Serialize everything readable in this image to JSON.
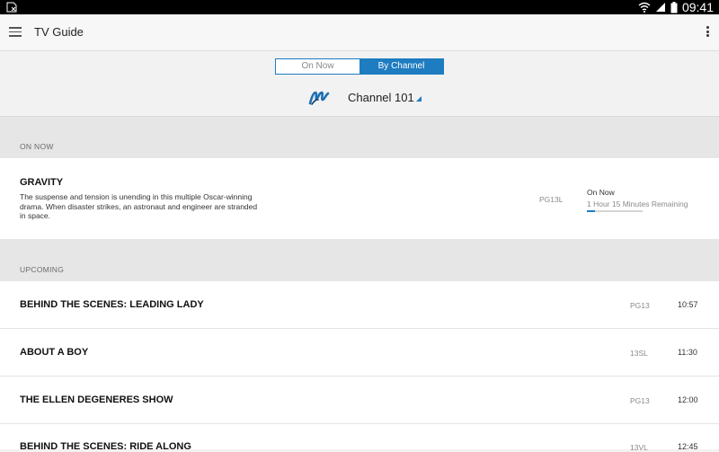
{
  "status_bar": {
    "time": "09:41"
  },
  "app": {
    "title": "TV Guide"
  },
  "segments": [
    "On Now",
    "By Channel"
  ],
  "channel": {
    "label": "Channel 101"
  },
  "sections": {
    "on_now": "ON NOW",
    "upcoming": "UPCOMING"
  },
  "on_now": {
    "title": "GRAVITY",
    "description": "The suspense and tension is unending in this multiple Oscar-winning drama. When disaster strikes, an astronaut and engineer are stranded in space.",
    "rating": "PG13L",
    "status": "On Now",
    "remaining": "1 Hour 15 Minutes Remaining",
    "progress_fraction": 0.15
  },
  "upcoming": [
    {
      "title": "BEHIND THE SCENES: LEADING LADY",
      "rating": "PG13",
      "time": "10:57"
    },
    {
      "title": "ABOUT A BOY",
      "rating": "13SL",
      "time": "11:30"
    },
    {
      "title": "THE ELLEN DEGENERES SHOW",
      "rating": "PG13",
      "time": "12:00"
    },
    {
      "title": "BEHIND THE SCENES: RIDE ALONG",
      "rating": "13VL",
      "time": "12:45"
    }
  ],
  "colors": {
    "accent": "#1e7cc0",
    "section_bg": "#e6e6e6",
    "row_bg": "#ffffff"
  },
  "icons": [
    "sim-missing-icon",
    "wifi-icon",
    "signal-icon",
    "battery-icon",
    "menu-icon",
    "overflow-menu-icon",
    "channel-logo-icon",
    "dropdown-caret-icon"
  ]
}
